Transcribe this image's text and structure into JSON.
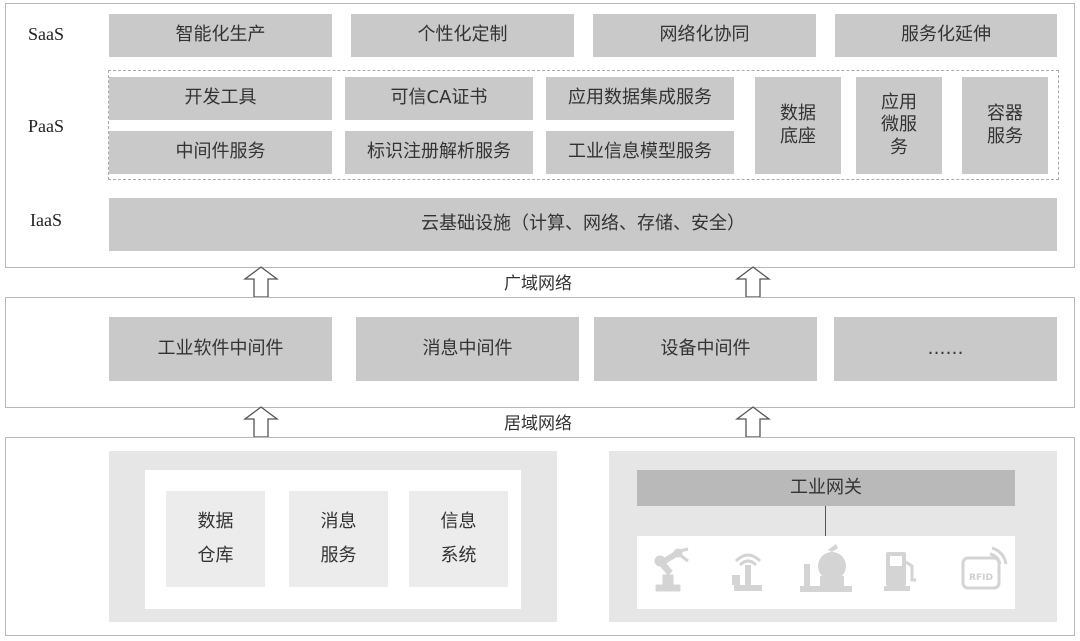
{
  "cloud": {
    "saas": {
      "label": "SaaS",
      "items": [
        "智能化生产",
        "个性化定制",
        "网络化协同",
        "服务化延伸"
      ]
    },
    "paas": {
      "label": "PaaS",
      "col1": [
        "开发工具",
        "中间件服务"
      ],
      "col2": [
        "可信CA证书",
        "标识注册解析服务"
      ],
      "col3": [
        "应用数据集成服务",
        "工业信息模型服务"
      ],
      "tall": [
        {
          "line1": "数据",
          "line2": "底座",
          "line3": ""
        },
        {
          "line1": "应用",
          "line2": "微服",
          "line3": "务"
        },
        {
          "line1": "容器",
          "line2": "服务",
          "line3": ""
        }
      ]
    },
    "iaas": {
      "label": "IaaS",
      "text": "云基础设施（计算、网络、存储、安全）"
    }
  },
  "wan_label": "广域网络",
  "middleware": {
    "items": [
      "工业软件中间件",
      "消息中间件",
      "设备中间件",
      "……"
    ]
  },
  "lan_label": "居域网络",
  "edge": {
    "tiles": [
      {
        "line1": "数据",
        "line2": "仓库"
      },
      {
        "line1": "消息",
        "line2": "服务"
      },
      {
        "line1": "信息",
        "line2": "系统"
      }
    ],
    "gateway": "工业网关",
    "devices": {
      "icons": [
        "robot-arm-icon",
        "antenna-icon",
        "tank-icon",
        "fuel-pump-icon",
        "rfid-icon"
      ],
      "rfid_text": "RFID"
    }
  }
}
